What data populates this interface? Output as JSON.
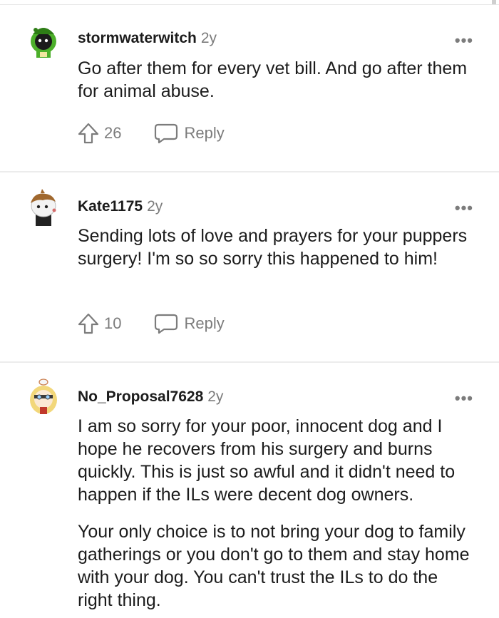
{
  "comments": [
    {
      "username": "stormwaterwitch",
      "age": "2y",
      "body": [
        "Go after them for every vet bill. And go after them for animal abuse."
      ],
      "votes": "26",
      "reply_label": "Reply",
      "more_label": "•••"
    },
    {
      "username": "Kate1175",
      "age": "2y",
      "body": [
        "Sending lots of love and prayers for your puppers surgery! I'm so so sorry this happened to him!"
      ],
      "votes": "10",
      "reply_label": "Reply",
      "more_label": "•••"
    },
    {
      "username": "No_Proposal7628",
      "age": "2y",
      "body": [
        "I am so sorry for your poor, innocent dog and I hope he recovers from his surgery and burns quickly. This is just so awful and it didn't need to happen if the ILs were decent dog owners.",
        "Your only choice is to not bring your dog to family gatherings or you don't go to them and stay home with your dog. You can't trust the ILs to do the right thing."
      ],
      "more_label": "•••"
    }
  ],
  "colors": {
    "text": "#1c1c1c",
    "muted": "#7c7c7c",
    "divider": "#ececec"
  },
  "icons": {
    "upvote": "upvote-arrow-icon",
    "reply": "speech-bubble-icon",
    "more": "ellipsis-icon"
  }
}
